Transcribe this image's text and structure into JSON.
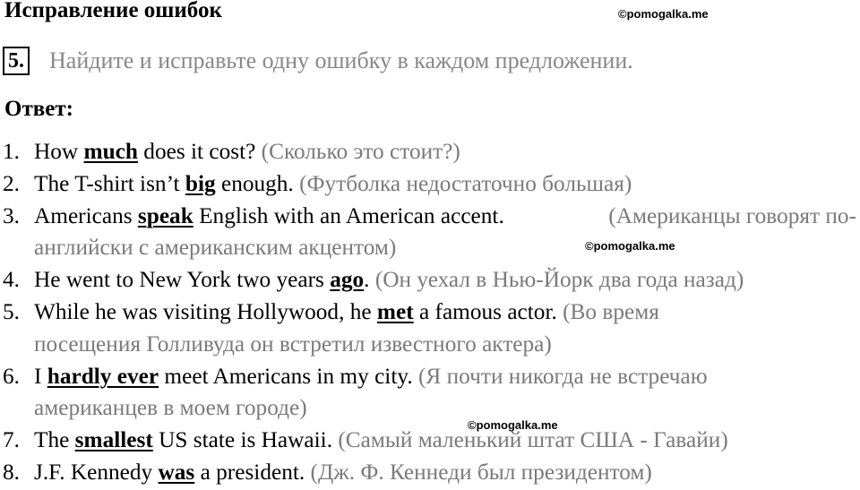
{
  "header": {
    "title": "Исправление ошибок",
    "watermark": "©pomogalka.me"
  },
  "task": {
    "number": "5.",
    "instruction": "Найдите и исправьте одну ошибку в каждом предложении."
  },
  "answer_label": "Ответ:",
  "items": [
    {
      "num": "1.",
      "pre": "How ",
      "hl": "much",
      "post": " does it cost?",
      "tr": " (Сколько это стоит?)"
    },
    {
      "num": "2.",
      "pre": "The T-shirt isn’t ",
      "hl": "big",
      "post": " enough.",
      "tr": " (Футболка недостаточно большая)"
    },
    {
      "num": "3.",
      "pre": "Americans ",
      "hl": "speak",
      "post": " English with an American accent.",
      "tr": " (Американцы говорят по-",
      "tr2": "английски с американским акцентом)"
    },
    {
      "num": "4.",
      "pre": "He went to New York two years ",
      "hl": "ago",
      "post": ".",
      "tr": " (Он уехал в Нью-Йорк два года назад)"
    },
    {
      "num": "5.",
      "pre": "While he was visiting Hollywood, he ",
      "hl": "met",
      "post": " a famous actor.",
      "tr": " (Во время",
      "tr2": "посещения Голливуда он встретил известного актера)"
    },
    {
      "num": "6.",
      "pre": "I ",
      "hl": "hardly ever",
      "post": " meet Americans in my city.",
      "tr": " (Я почти никогда не встречаю",
      "tr2": "американцев в моем городе)"
    },
    {
      "num": "7.",
      "pre": "The ",
      "hl": "smallest",
      "post": " US state is Hawaii.",
      "tr": " (Самый маленький штат США - Гавайи)"
    },
    {
      "num": "8.",
      "pre": "J.F. Kennedy ",
      "hl": "was",
      "post": " a president.",
      "tr": " (Дж. Ф. Кеннеди был президентом)"
    }
  ]
}
